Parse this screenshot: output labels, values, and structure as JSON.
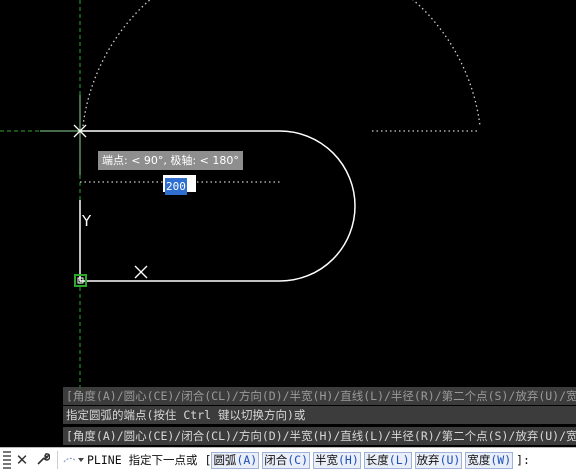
{
  "tooltip": {
    "text": "端点: < 90°, 极轴: < 180°"
  },
  "dynamic_input": {
    "value": "200"
  },
  "axis_label": "Y",
  "command_history": [
    "[角度(A)/圆心(CE)/闭合(CL)/方向(D)/半宽(H)/直线(L)/半径(R)/第二个点(S)/放弃(U)/宽度(W)]:",
    "指定圆弧的端点(按住 Ctrl 键以切换方向)或",
    "[角度(A)/圆心(CE)/闭合(CL)/方向(D)/半宽(H)/直线(L)/半径(R)/第二个点(S)/放弃(U)/宽度(W)]:"
  ],
  "command_line": {
    "command": "PLINE",
    "prompt": "指定下一点或",
    "open_bracket": "[",
    "close_bracket": "]:",
    "options": [
      {
        "label": "圆弧",
        "key": "(A)"
      },
      {
        "label": "闭合",
        "key": "(C)"
      },
      {
        "label": "半宽",
        "key": "(H)"
      },
      {
        "label": "长度",
        "key": "(L)"
      },
      {
        "label": "放弃",
        "key": "(U)"
      },
      {
        "label": "宽度",
        "key": "(W)"
      }
    ]
  },
  "colors": {
    "background": "#000000",
    "geometry": "#ffffff",
    "tracking_green": "#2aa82a",
    "selection_blue": "#2f6fd1"
  }
}
